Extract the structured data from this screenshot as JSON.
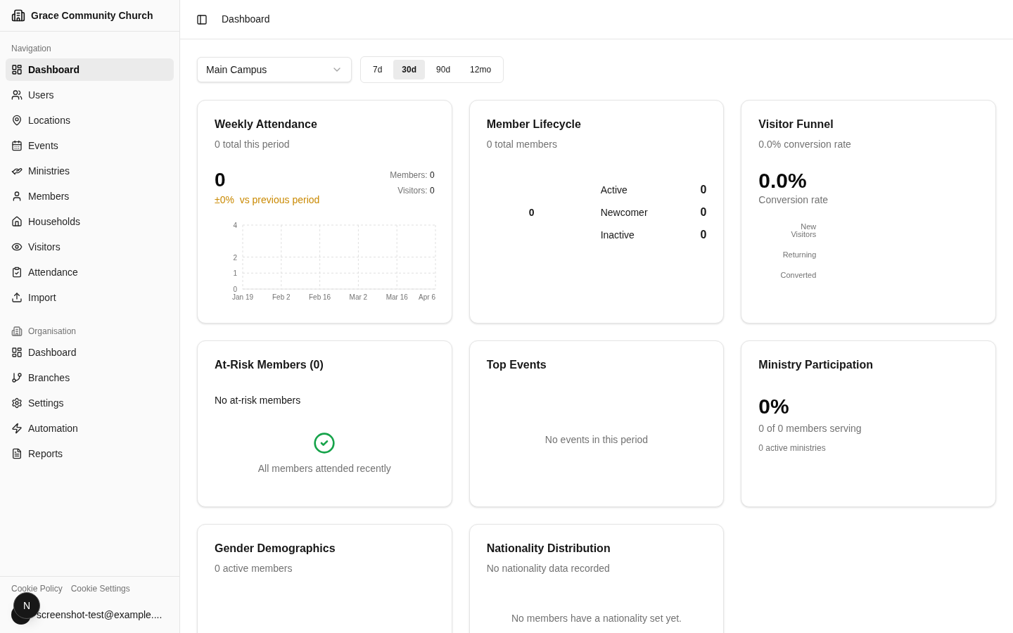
{
  "sidebar": {
    "brand": "Grace Community Church",
    "sections": [
      {
        "label": "Navigation",
        "kind": "plain",
        "items": [
          {
            "label": "Dashboard",
            "selected": true
          },
          {
            "label": "Users",
            "selected": false
          },
          {
            "label": "Locations",
            "selected": false
          },
          {
            "label": "Events",
            "selected": false
          },
          {
            "label": "Ministries",
            "selected": false
          },
          {
            "label": "Members",
            "selected": false
          },
          {
            "label": "Households",
            "selected": false
          },
          {
            "label": "Visitors",
            "selected": false
          },
          {
            "label": "Attendance",
            "selected": false
          },
          {
            "label": "Import",
            "selected": false
          }
        ]
      },
      {
        "label": "Organisation",
        "kind": "icon",
        "items": [
          {
            "label": "Dashboard",
            "selected": false
          },
          {
            "label": "Branches",
            "selected": false
          },
          {
            "label": "Settings",
            "selected": false
          },
          {
            "label": "Automation",
            "selected": false
          },
          {
            "label": "Reports",
            "selected": false
          }
        ]
      }
    ],
    "footer_links": [
      "Cookie Policy",
      "Cookie Settings"
    ],
    "user": {
      "email": "screenshot-test@example....",
      "badge": "N"
    }
  },
  "header": {
    "title": "Dashboard"
  },
  "filters": {
    "campus": "Main Campus",
    "periods": [
      {
        "label": "7d",
        "selected": false
      },
      {
        "label": "30d",
        "selected": true
      },
      {
        "label": "90d",
        "selected": false
      },
      {
        "label": "12mo",
        "selected": false
      }
    ]
  },
  "cards": [
    {
      "kind": "attendance",
      "title": "Weekly Attendance",
      "subtitle": "0 total this period",
      "value": "0",
      "change": "±0%  vs previous period",
      "members_label": "Members:",
      "members": "0",
      "visitors_label": "Visitors:",
      "visitors": "0",
      "chart_data": {
        "type": "line",
        "categories": [
          "Jan 19",
          "Feb 2",
          "Feb 16",
          "Mar 2",
          "Mar 16",
          "Apr 6"
        ],
        "ylim": [
          0,
          4
        ],
        "yticks": [
          0,
          1,
          2,
          4
        ],
        "grid": true
      }
    },
    {
      "kind": "lifecycle",
      "title": "Member Lifecycle",
      "subtitle": "0 total members",
      "center": "0",
      "rows": [
        {
          "label": "Active",
          "value": "0"
        },
        {
          "label": "Newcomer",
          "value": "0"
        },
        {
          "label": "Inactive",
          "value": "0"
        }
      ]
    },
    {
      "kind": "funnel",
      "title": "Visitor Funnel",
      "subtitle": "0.0% conversion rate",
      "value": "0.0%",
      "value_label": "Conversion rate",
      "stages": [
        "New\nVisitors",
        "Returning",
        "Converted"
      ]
    },
    {
      "kind": "atrisk",
      "title": "At-Risk Members (0)",
      "heading": "No at-risk members",
      "message": "All members attended recently"
    },
    {
      "kind": "empty",
      "title": "Top Events",
      "message": "No events in this period"
    },
    {
      "kind": "ministry",
      "title": "Ministry Participation",
      "value": "0%",
      "line1": "0 of 0 members serving",
      "line2": "0 active ministries"
    },
    {
      "kind": "gender",
      "title": "Gender Demographics",
      "subtitle": "0 active members"
    },
    {
      "kind": "nationality",
      "title": "Nationality Distribution",
      "subtitle": "No nationality data recorded",
      "message": "No members have a nationality set yet."
    }
  ]
}
